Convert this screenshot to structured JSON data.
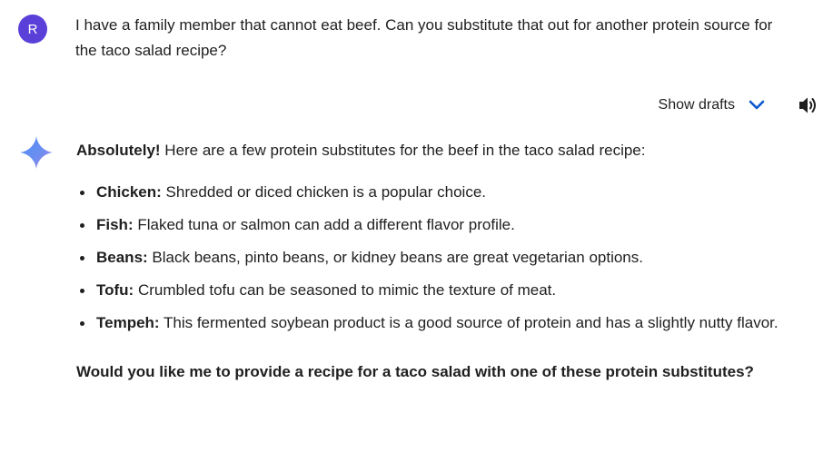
{
  "user_message": {
    "avatar_initial": "R",
    "avatar_color": "#5b3fd9",
    "text": "I have a family member that cannot eat beef. Can you substitute that out for another protein source for the taco salad recipe?"
  },
  "toolbar": {
    "show_drafts_label": "Show drafts",
    "chevron_icon": "chevron-down-icon",
    "speaker_icon": "volume-up-icon",
    "accent_color": "#0b57d0"
  },
  "response": {
    "intro_bold": "Absolutely!",
    "intro_rest": " Here are a few protein substitutes for the beef in the taco salad recipe:",
    "items": [
      {
        "term": "Chicken:",
        "desc": " Shredded or diced chicken is a popular choice."
      },
      {
        "term": "Fish:",
        "desc": " Flaked tuna or salmon can add a different flavor profile."
      },
      {
        "term": "Beans:",
        "desc": " Black beans, pinto beans, or kidney beans are great vegetarian options."
      },
      {
        "term": "Tofu:",
        "desc": " Crumbled tofu can be seasoned to mimic the texture of meat."
      },
      {
        "term": "Tempeh:",
        "desc": " This fermented soybean product is a good source of protein and has a slightly nutty flavor."
      }
    ],
    "question": "Would you like me to provide a recipe for a taco salad with one of these protein substitutes?"
  }
}
